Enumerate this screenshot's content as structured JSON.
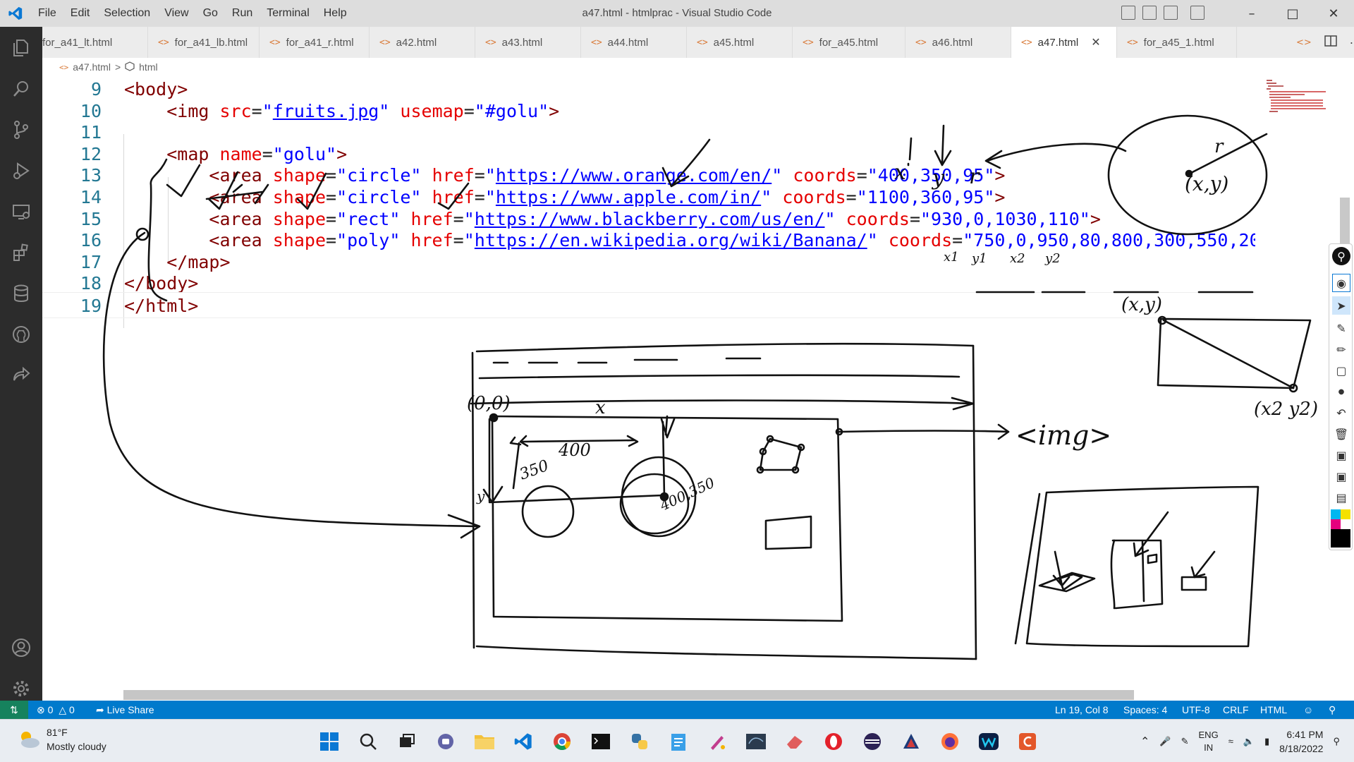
{
  "window": {
    "title": "a47.html - htmlprac - Visual Studio Code",
    "menu": [
      "File",
      "Edit",
      "Selection",
      "View",
      "Go",
      "Run",
      "Terminal",
      "Help"
    ]
  },
  "tabs": [
    {
      "label": "for_a41_lt.html",
      "active": false
    },
    {
      "label": "for_a41_lb.html",
      "active": false
    },
    {
      "label": "for_a41_r.html",
      "active": false
    },
    {
      "label": "a42.html",
      "active": false
    },
    {
      "label": "a43.html",
      "active": false
    },
    {
      "label": "a44.html",
      "active": false
    },
    {
      "label": "a45.html",
      "active": false
    },
    {
      "label": "for_a45.html",
      "active": false
    },
    {
      "label": "a46.html",
      "active": false
    },
    {
      "label": "a47.html",
      "active": true
    },
    {
      "label": "for_a45_1.html",
      "active": false
    }
  ],
  "breadcrumb": {
    "file": "a47.html",
    "sep": ">",
    "node": "html"
  },
  "code": {
    "lines": [
      {
        "n": "9",
        "tokens": [
          {
            "c": "t",
            "v": "<body>"
          }
        ]
      },
      {
        "n": "10",
        "tokens": [
          {
            "c": "p",
            "v": "    "
          },
          {
            "c": "t",
            "v": "<img"
          },
          {
            "c": "p",
            "v": " "
          },
          {
            "c": "a",
            "v": "src"
          },
          {
            "c": "p",
            "v": "="
          },
          {
            "c": "s",
            "v": "\""
          },
          {
            "c": "u",
            "v": "fruits.jpg"
          },
          {
            "c": "s",
            "v": "\""
          },
          {
            "c": "p",
            "v": " "
          },
          {
            "c": "a",
            "v": "usemap"
          },
          {
            "c": "p",
            "v": "="
          },
          {
            "c": "s",
            "v": "\"#golu\""
          },
          {
            "c": "t",
            "v": ">"
          }
        ]
      },
      {
        "n": "11",
        "tokens": []
      },
      {
        "n": "12",
        "tokens": [
          {
            "c": "p",
            "v": "    "
          },
          {
            "c": "t",
            "v": "<map"
          },
          {
            "c": "p",
            "v": " "
          },
          {
            "c": "a",
            "v": "name"
          },
          {
            "c": "p",
            "v": "="
          },
          {
            "c": "s",
            "v": "\"golu\""
          },
          {
            "c": "t",
            "v": ">"
          }
        ]
      },
      {
        "n": "13",
        "tokens": [
          {
            "c": "p",
            "v": "        "
          },
          {
            "c": "t",
            "v": "<area"
          },
          {
            "c": "p",
            "v": " "
          },
          {
            "c": "a",
            "v": "shape"
          },
          {
            "c": "p",
            "v": "="
          },
          {
            "c": "s",
            "v": "\"circle\""
          },
          {
            "c": "p",
            "v": " "
          },
          {
            "c": "a",
            "v": "href"
          },
          {
            "c": "p",
            "v": "="
          },
          {
            "c": "s",
            "v": "\""
          },
          {
            "c": "u",
            "v": "https://www.orange.com/en/"
          },
          {
            "c": "s",
            "v": "\""
          },
          {
            "c": "p",
            "v": " "
          },
          {
            "c": "a",
            "v": "coords"
          },
          {
            "c": "p",
            "v": "="
          },
          {
            "c": "s",
            "v": "\"400,350,95\""
          },
          {
            "c": "t",
            "v": ">"
          }
        ]
      },
      {
        "n": "14",
        "tokens": [
          {
            "c": "p",
            "v": "        "
          },
          {
            "c": "t",
            "v": "<area"
          },
          {
            "c": "p",
            "v": " "
          },
          {
            "c": "a",
            "v": "shape"
          },
          {
            "c": "p",
            "v": "="
          },
          {
            "c": "s",
            "v": "\"circle\""
          },
          {
            "c": "p",
            "v": " "
          },
          {
            "c": "a",
            "v": "href"
          },
          {
            "c": "p",
            "v": "="
          },
          {
            "c": "s",
            "v": "\""
          },
          {
            "c": "u",
            "v": "https://www.apple.com/in/"
          },
          {
            "c": "s",
            "v": "\""
          },
          {
            "c": "p",
            "v": " "
          },
          {
            "c": "a",
            "v": "coords"
          },
          {
            "c": "p",
            "v": "="
          },
          {
            "c": "s",
            "v": "\"1100,360,95\""
          },
          {
            "c": "t",
            "v": ">"
          }
        ]
      },
      {
        "n": "15",
        "tokens": [
          {
            "c": "p",
            "v": "        "
          },
          {
            "c": "t",
            "v": "<area"
          },
          {
            "c": "p",
            "v": " "
          },
          {
            "c": "a",
            "v": "shape"
          },
          {
            "c": "p",
            "v": "="
          },
          {
            "c": "s",
            "v": "\"rect\""
          },
          {
            "c": "p",
            "v": " "
          },
          {
            "c": "a",
            "v": "href"
          },
          {
            "c": "p",
            "v": "="
          },
          {
            "c": "s",
            "v": "\""
          },
          {
            "c": "u",
            "v": "https://www.blackberry.com/us/en/"
          },
          {
            "c": "s",
            "v": "\""
          },
          {
            "c": "p",
            "v": " "
          },
          {
            "c": "a",
            "v": "coords"
          },
          {
            "c": "p",
            "v": "="
          },
          {
            "c": "s",
            "v": "\"930,0,1030,110\""
          },
          {
            "c": "t",
            "v": ">"
          }
        ]
      },
      {
        "n": "16",
        "tokens": [
          {
            "c": "p",
            "v": "        "
          },
          {
            "c": "t",
            "v": "<area"
          },
          {
            "c": "p",
            "v": " "
          },
          {
            "c": "a",
            "v": "shape"
          },
          {
            "c": "p",
            "v": "="
          },
          {
            "c": "s",
            "v": "\"poly\""
          },
          {
            "c": "p",
            "v": " "
          },
          {
            "c": "a",
            "v": "href"
          },
          {
            "c": "p",
            "v": "="
          },
          {
            "c": "s",
            "v": "\""
          },
          {
            "c": "u",
            "v": "https://en.wikipedia.org/wiki/Banana/"
          },
          {
            "c": "s",
            "v": "\""
          },
          {
            "c": "p",
            "v": " "
          },
          {
            "c": "a",
            "v": "coords"
          },
          {
            "c": "p",
            "v": "="
          },
          {
            "c": "s",
            "v": "\"750,0,950,80,800,300,550,20"
          }
        ]
      },
      {
        "n": "17",
        "tokens": [
          {
            "c": "p",
            "v": "    "
          },
          {
            "c": "t",
            "v": "</map>"
          }
        ]
      },
      {
        "n": "18",
        "tokens": [
          {
            "c": "t",
            "v": "</body>"
          }
        ]
      },
      {
        "n": "19",
        "tokens": [
          {
            "c": "t",
            "v": "</html>"
          }
        ]
      }
    ]
  },
  "annotations": {
    "x_label": "x",
    "y_label": "y",
    "r_label": "r",
    "xy_label": "(x,y)",
    "x1y1_label": "(x,y)",
    "x2y2_label": "(x2 y2)",
    "coord_sub": [
      "x1",
      "y1",
      "x2",
      "y2"
    ],
    "origin_label": "(0,0)",
    "axis_x": "x",
    "axis_y": "y",
    "dist_400": "400",
    "dist_350": "350",
    "point_label": "400,350",
    "img_label": "<img>"
  },
  "statusbar": {
    "errors": "0",
    "warnings": "0",
    "liveshare": "Live Share",
    "position": "Ln 19, Col 8",
    "spaces": "Spaces: 4",
    "encoding": "UTF-8",
    "eol": "CRLF",
    "language": "HTML"
  },
  "taskbar": {
    "weather_temp": "81°F",
    "weather_desc": "Mostly cloudy",
    "lang": "ENG",
    "region": "IN",
    "time": "6:41 PM",
    "date": "8/18/2022"
  }
}
